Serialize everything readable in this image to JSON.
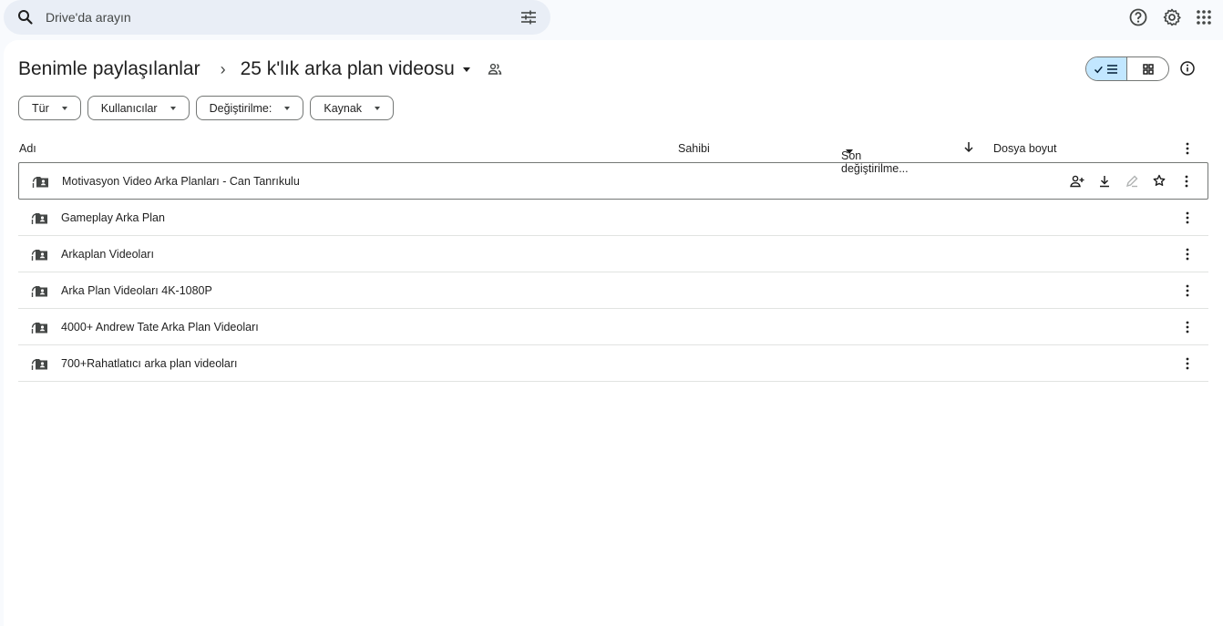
{
  "search": {
    "placeholder": "Drive'da arayın"
  },
  "breadcrumb": {
    "root": "Benimle paylaşılanlar",
    "separator": "›",
    "current": "25 k'lık arka plan videosu"
  },
  "filters": [
    {
      "label": "Tür"
    },
    {
      "label": "Kullanıcılar"
    },
    {
      "label": "Değiştirilme:"
    },
    {
      "label": "Kaynak"
    }
  ],
  "table": {
    "columns": {
      "name": "Adı",
      "owner": "Sahibi",
      "modified": "Son değiştirilme...",
      "size": "Dosya boyut"
    },
    "rows": [
      {
        "name": "Motivasyon Video Arka Planları - Can Tanrıkulu"
      },
      {
        "name": "Gameplay Arka Plan"
      },
      {
        "name": "Arkaplan Videoları"
      },
      {
        "name": "Arka Plan Videoları 4K-1080P"
      },
      {
        "name": "4000+ Andrew Tate Arka Plan Videoları"
      },
      {
        "name": "700+Rahatlatıcı arka plan videoları"
      }
    ]
  },
  "colors": {
    "accent_selected": "#c2e7ff",
    "search_bg": "#e9eef6",
    "page_bg": "#f8fafd"
  },
  "icons": [
    "search-icon",
    "filter-options-icon",
    "help-icon",
    "settings-icon",
    "apps-grid-icon",
    "shared-people-icon",
    "list-view-icon",
    "grid-view-icon",
    "info-icon",
    "shared-folder-icon",
    "share-user-icon",
    "download-icon",
    "rename-icon",
    "star-icon",
    "more-vert-icon",
    "sort-arrow-icon"
  ]
}
